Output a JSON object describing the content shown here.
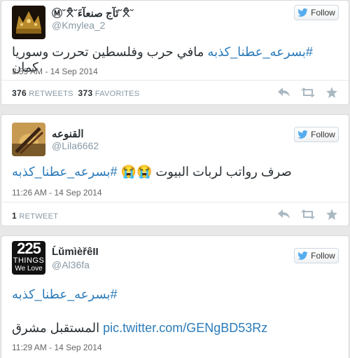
{
  "tweets": [
    {
      "name": "Ⓜ˘ꉦ˘تَآج صنعآءَ˘ꉦ˘",
      "handle": "@Kmylea_2",
      "follow_label": "Follow",
      "text_hashtag": "#بسرعه_عطنا_كذبه",
      "text_body": " مافي حرب وفلسطين تحررت وسوريا كمان",
      "date": "3:59 AM - 14 Sep 2014",
      "retweets_count": "376",
      "retweets_label": "RETWEETS",
      "favorites_count": "373",
      "favorites_label": "FAVORITES"
    },
    {
      "name": "القنوعه",
      "handle": "@Lila6662",
      "follow_label": "Follow",
      "text_body": "صرف رواتب لربات البيوت 😭😭 ",
      "text_hashtag": "#بسرعه_عطنا_كذبه",
      "date": "11:26 AM - 14 Sep 2014",
      "retweets_count": "1",
      "retweets_label": "RETWEET"
    },
    {
      "name": "ĹŭmìèřêII",
      "handle": "@Al36fa",
      "follow_label": "Follow",
      "text_hashtag": "#بسرعه_عطنا_كذبه",
      "text_body": "المستقبل مشرق",
      "link": "pic.twitter.com/GENgBD53Rz",
      "date": "11:29 AM - 14 Sep 2014",
      "avatar_text": [
        "225",
        "THINGS",
        "We Love"
      ]
    }
  ],
  "colors": {
    "hashtag": "#2b7bb9",
    "muted": "#8899a6",
    "action_icon": "#aab8c2",
    "twitter_bird": "#55acee"
  }
}
